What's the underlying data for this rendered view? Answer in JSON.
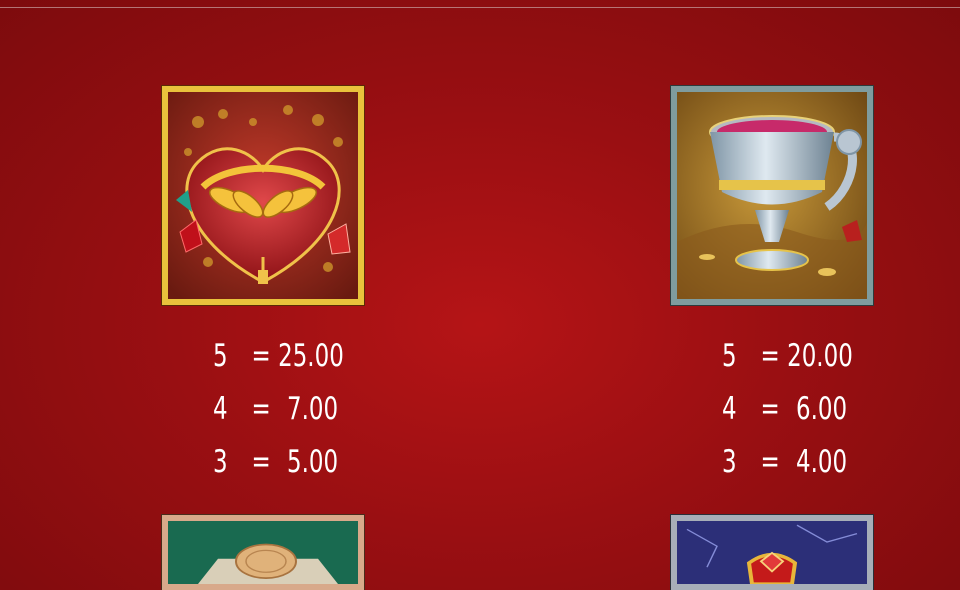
{
  "symbols": [
    {
      "name": "heart-laurel",
      "icon": "heart-laurel-icon",
      "paytable": [
        {
          "count": "5",
          "equals": "=",
          "value": "25.00"
        },
        {
          "count": "4",
          "equals": "=",
          "value": "7.00"
        },
        {
          "count": "3",
          "equals": "=",
          "value": "5.00"
        }
      ]
    },
    {
      "name": "silver-chalice",
      "icon": "chalice-icon",
      "paytable": [
        {
          "count": "5",
          "equals": "=",
          "value": "20.00"
        },
        {
          "count": "4",
          "equals": "=",
          "value": "6.00"
        },
        {
          "count": "3",
          "equals": "=",
          "value": "4.00"
        }
      ]
    },
    {
      "name": "coin-chest",
      "icon": "coin-icon"
    },
    {
      "name": "ruby-crown",
      "icon": "ruby-crown-icon"
    }
  ],
  "colors": {
    "background": "#b51416",
    "gold_frame": "#e9c23c",
    "silver_frame": "#7f9c9e",
    "text": "#ffffff"
  }
}
